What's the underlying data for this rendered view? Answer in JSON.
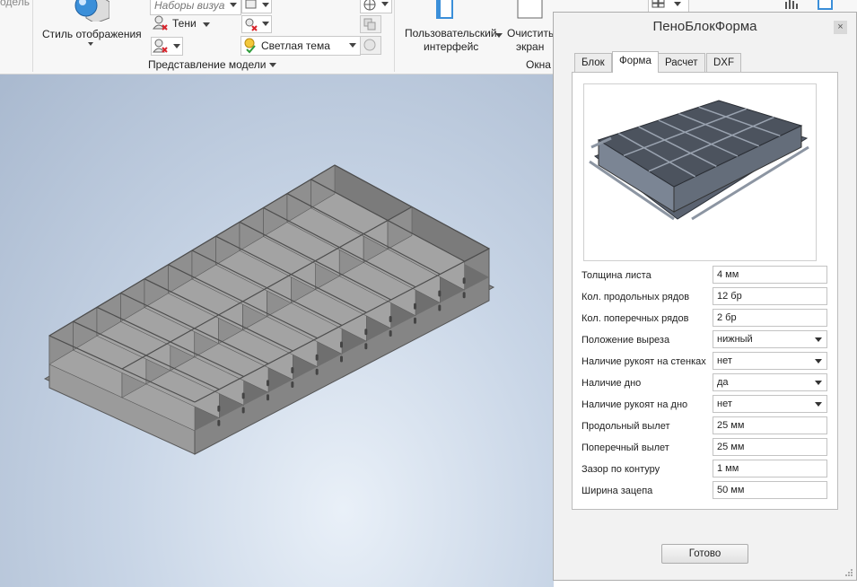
{
  "ribbon": {
    "cut_left_label": "одель",
    "display_style_label": "Стиль отображения",
    "visual_presets_label": "Наборы визуа",
    "shadows_label": "Тени",
    "theme_label": "Светлая тема",
    "model_view_label": "Представление модели",
    "user_interface_label_1": "Пользовательский",
    "user_interface_label_2": "интерфейс",
    "clear_screen_label_1": "Очистить",
    "clear_screen_label_2": "экран",
    "windows_group_label": "Окна"
  },
  "dialog": {
    "title": "ПеноБлокФорма",
    "close_glyph": "×",
    "tabs": [
      {
        "label": "Блок",
        "active": false
      },
      {
        "label": "Форма",
        "active": true
      },
      {
        "label": "Расчет",
        "active": false
      },
      {
        "label": "DXF",
        "active": false
      }
    ],
    "fields": [
      {
        "label": "Толщина листа",
        "value": "4 мм",
        "type": "text"
      },
      {
        "label": "Кол. продольных рядов",
        "value": "12 бр",
        "type": "text"
      },
      {
        "label": "Кол. поперечных рядов",
        "value": "2 бр",
        "type": "text"
      },
      {
        "label": "Положение выреза",
        "value": "нижный",
        "type": "select"
      },
      {
        "label": "Наличие рукоят на стенках",
        "value": "нет",
        "type": "select"
      },
      {
        "label": "Наличие дно",
        "value": "да",
        "type": "select"
      },
      {
        "label": "Наличие рукоят на дно",
        "value": "нет",
        "type": "select"
      },
      {
        "label": "Продольный вылет",
        "value": "25 мм",
        "type": "text"
      },
      {
        "label": "Поперечный вылет",
        "value": "25 мм",
        "type": "text"
      },
      {
        "label": "Зазор по контуру",
        "value": "1 мм",
        "type": "text"
      },
      {
        "label": "Ширина зацепа",
        "value": "50 мм",
        "type": "text"
      }
    ],
    "done_label": "Готово"
  },
  "colors": {
    "accent_blue": "#3b8fd9",
    "viewport_bg": "#b9c8dc",
    "model_gray": "#8e8e8e"
  }
}
